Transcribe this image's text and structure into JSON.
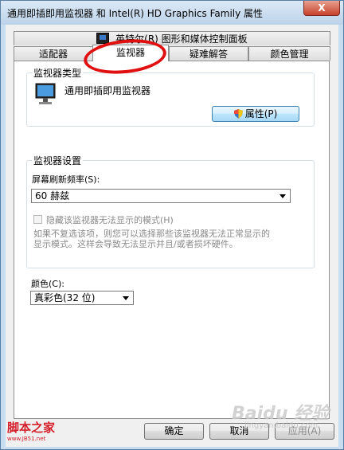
{
  "window": {
    "title": "通用即插即用监视器 和 Intel(R) HD Graphics Family 属性",
    "close_label": "X"
  },
  "tabs": {
    "top": "英特尔(R) 图形和媒体控制面板",
    "row2": [
      "适配器",
      "监视器",
      "疑难解答",
      "颜色管理"
    ],
    "active_index": 1
  },
  "monitor_type": {
    "group_label": "监视器类型",
    "device_name": "通用即插即用监视器",
    "properties_button": "属性(P)"
  },
  "monitor_settings": {
    "group_label": "监视器设置",
    "refresh_label": "屏幕刷新频率(S):",
    "refresh_value": "60 赫兹",
    "hide_modes_label": "隐藏该监视器无法显示的模式(H)",
    "hide_modes_checked": false,
    "description_line1": "如果不复选该项，则您可以选择那些该监视器无法正常显示的",
    "description_line2": "显示模式。这样会导致无法显示并且/或者损坏硬件。"
  },
  "colors": {
    "label": "颜色(C):",
    "value": "真彩色(32 位)"
  },
  "footer": {
    "ok_label": "确定",
    "cancel_label": "取消",
    "apply_label": "应用(A)"
  },
  "watermarks": {
    "left_title": "脚本之家",
    "left_url": "www.JB51.net",
    "right_brand": "Baidu 经验",
    "right_url": "jingyan.baidu.com"
  },
  "accent_colors": {
    "annotation_circle": "#e11010",
    "watermark_red": "#d4202b"
  }
}
